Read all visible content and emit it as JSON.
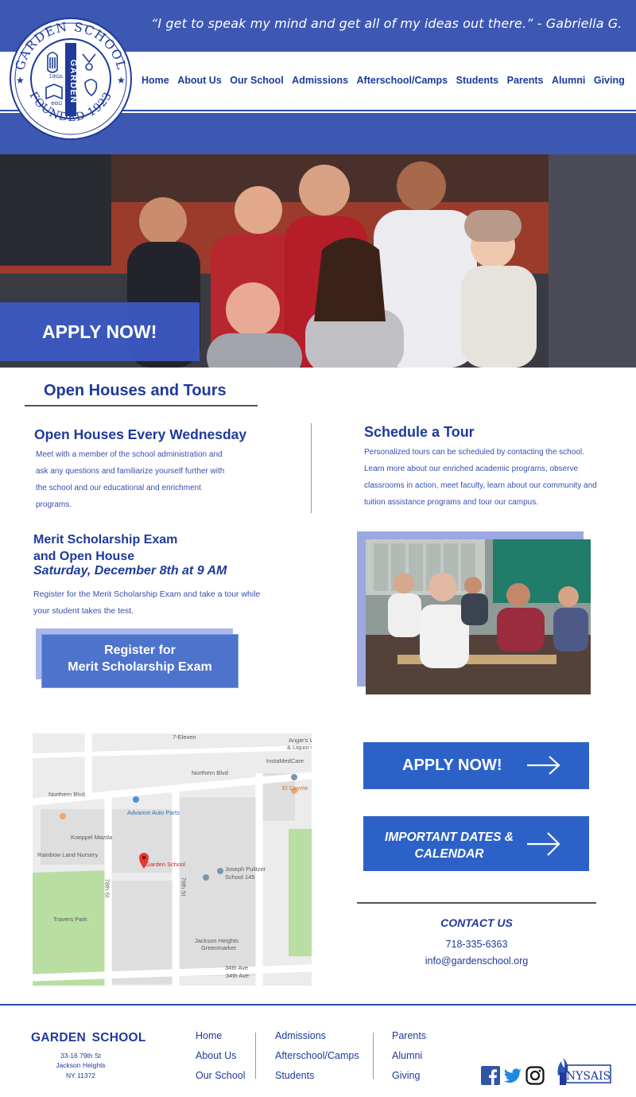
{
  "header": {
    "quote": "“I get to speak my mind and get all of my ideas out there.” - Gabriella G.",
    "logo": {
      "top_text": "GARDEN SCHOOL",
      "bottom_text": "FOUNDED 1923",
      "center_text": "GARDEN"
    },
    "nav": [
      "Home",
      "About Us",
      "Our School",
      "Admissions",
      "Afterschool/Camps",
      "Students",
      "Parents",
      "Alumni",
      "Giving"
    ]
  },
  "hero": {
    "apply_label": "APPLY NOW!"
  },
  "open_houses": {
    "section_title": "Open Houses and Tours",
    "left_title": "Open Houses Every Wednesday",
    "left_body": "Meet with a member of the school administration and ask any questions and familiarize yourself further with the school and our educational and enrichment programs.",
    "right_title": "Schedule a Tour",
    "right_body": "Personalized tours can be scheduled by contacting the school. Learn more about  our enriched academic programs, observe classrooms in action, meet faculty, learn about our community and tuition assistance programs and tour our campus."
  },
  "merit": {
    "title_line1": "Merit Scholarship Exam",
    "title_line2": "and Open House",
    "date": "Saturday, December 8th at 9 AM",
    "body": "Register for the Merit Scholarship Exam and take a tour while your student takes the test.",
    "button_line1": "Register for",
    "button_line2": "Merit Scholarship Exam"
  },
  "map": {
    "labels": {
      "seven_eleven": "7-Eleven",
      "angies": "Angie's W",
      "liquor": "& Liquor C",
      "instamed": "InstaMedCare",
      "northern_blvd_1": "Northern Blvd",
      "northern_blvd_2": "Northern Blvd",
      "el_coyote": "El Coyote",
      "advance": "Advance Auto Parts",
      "koeppel": "Koeppel Mazda",
      "rainbow": "Rainbow Land Nursery",
      "garden_school": "Garden School",
      "pulitzer_1": "Joseph Pulitzer",
      "pulitzer_2": "School 145",
      "travers": "Travers Park",
      "jh_green_1": "Jackson Heights",
      "jh_green_2": "Greenmarket",
      "ave_34_1": "34th Ave",
      "ave_34_2": "34th Ave",
      "st_78": "78th St",
      "st_79": "79th St"
    }
  },
  "cta": {
    "apply_label": "APPLY NOW!",
    "dates_line1": "IMPORTANT DATES &",
    "dates_line2": "CALENDAR"
  },
  "contact": {
    "title": "CONTACT US",
    "phone": "718-335-6363",
    "email": "info@gardenschool.org"
  },
  "footer": {
    "school_name": "GARDEN  SCHOOL",
    "address_line1": "33-16 79th St",
    "address_line2": "Jackson Heights",
    "address_line3": "NY 11372",
    "col1": [
      "Home",
      "About Us",
      "Our School"
    ],
    "col2": [
      "Admissions",
      "Afterschool/Camps",
      "Students"
    ],
    "col3": [
      "Parents",
      "Alumni",
      "Giving"
    ],
    "social_icons": [
      "facebook-icon",
      "twitter-icon",
      "instagram-icon"
    ],
    "nysais_logo": "NYSAIS"
  },
  "colors": {
    "brand_blue": "#3d58b2",
    "text_navy": "#1e3a9b",
    "cta_blue": "#2c62c8"
  }
}
